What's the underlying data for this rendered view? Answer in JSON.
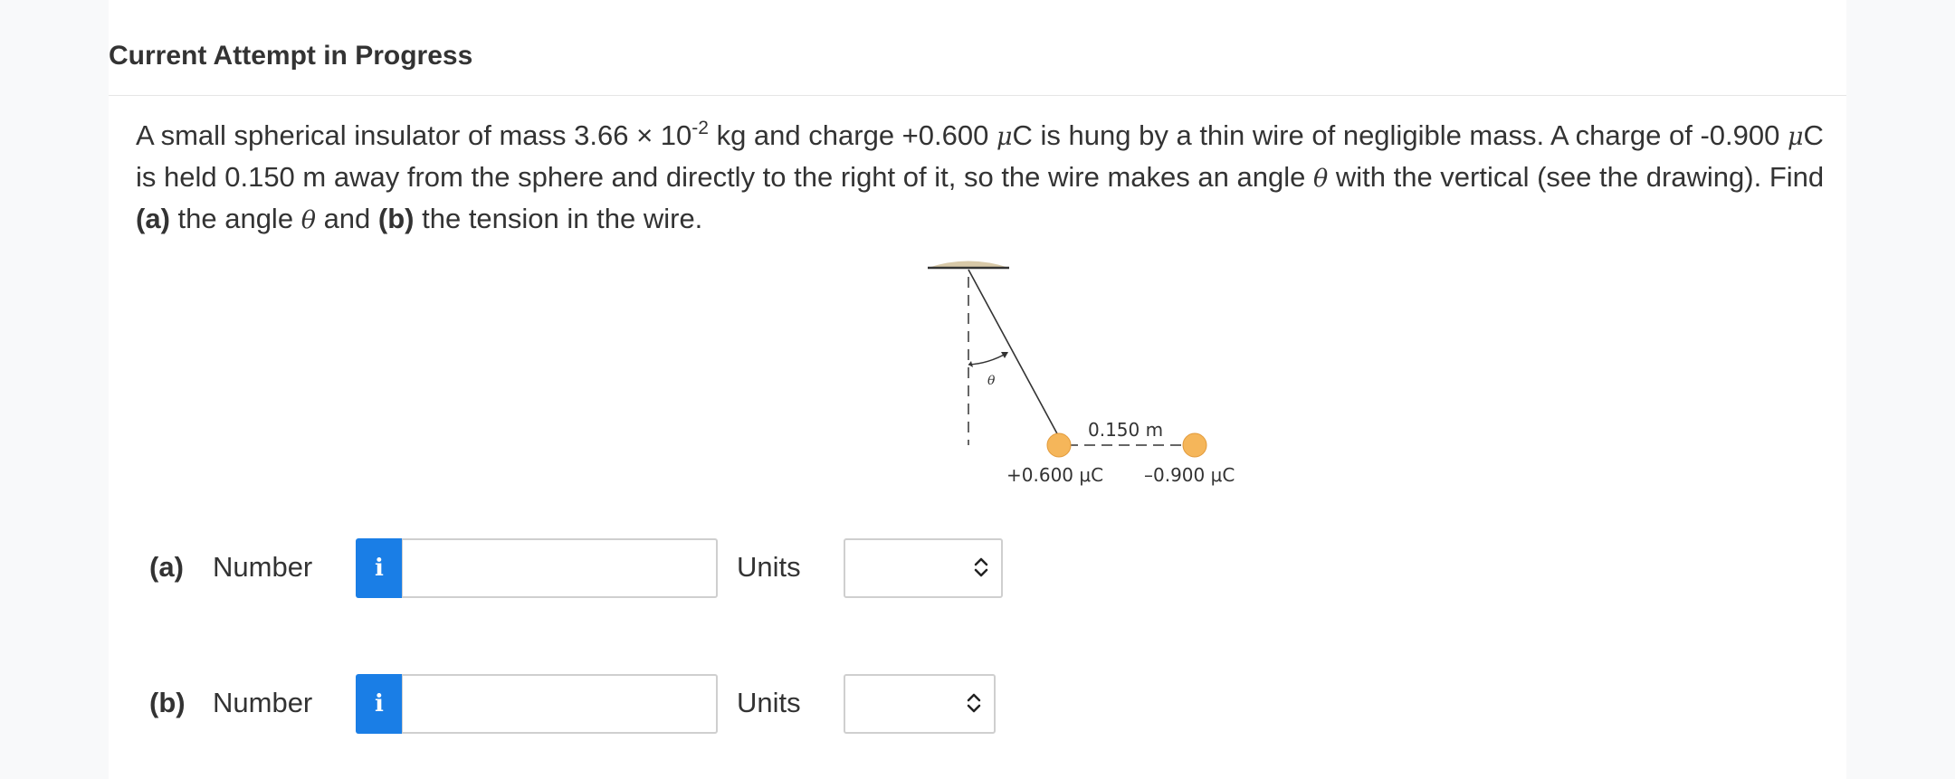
{
  "header": {
    "title": "Current Attempt in Progress"
  },
  "question": {
    "t1": "A small spherical insulator of mass 3.66 × 10",
    "exp": "-2",
    "t2": " kg and charge +0.600 ",
    "mu": "μ",
    "t3": "C is hung by a thin wire of negligible mass. A charge of -0.900 ",
    "t4": "C is held 0.150 m away from the sphere and directly to the right of it, so the wire makes an angle ",
    "theta": "θ",
    "t5": " with the vertical (see the drawing). Find ",
    "a": "(a)",
    "t6": " the angle ",
    "t7": " and ",
    "b": "(b)",
    "t8": " the tension in the wire."
  },
  "figure": {
    "theta_label": "θ",
    "distance": "0.150 m",
    "left_charge": "+0.600 μC",
    "right_charge": "–0.900 μC",
    "colors": {
      "sphere": "#f5b65a",
      "ceiling": "#d8c9a8"
    }
  },
  "answers": [
    {
      "part": "(a)",
      "number_label": "Number",
      "info_icon": "i",
      "value": "",
      "units_label": "Units",
      "units_value": ""
    },
    {
      "part": "(b)",
      "number_label": "Number",
      "info_icon": "i",
      "value": "",
      "units_label": "Units",
      "units_value": ""
    }
  ]
}
